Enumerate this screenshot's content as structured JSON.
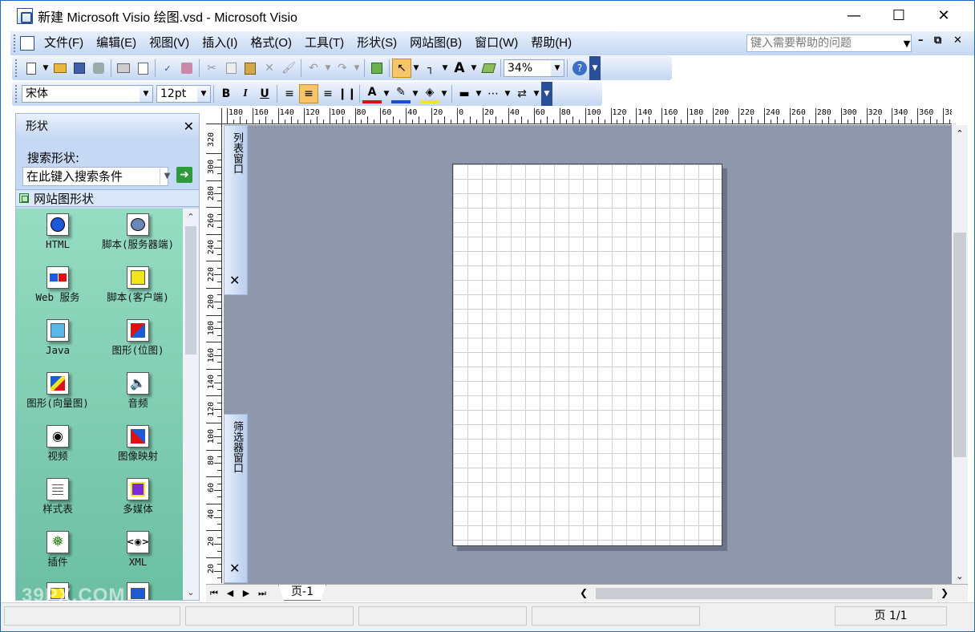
{
  "window": {
    "title": "新建 Microsoft Visio 绘图.vsd - Microsoft Visio"
  },
  "menu": {
    "items": [
      "文件(F)",
      "编辑(E)",
      "视图(V)",
      "插入(I)",
      "格式(O)",
      "工具(T)",
      "形状(S)",
      "网站图(B)",
      "窗口(W)",
      "帮助(H)"
    ],
    "help_placeholder": "键入需要帮助的问题"
  },
  "toolbar": {
    "zoom": "34%"
  },
  "format_toolbar": {
    "font": "宋体",
    "size": "12pt"
  },
  "shapes_panel": {
    "title": "形状",
    "search_label": "搜索形状:",
    "search_placeholder": "在此键入搜索条件",
    "stencil_name": "网站图形状",
    "items": [
      {
        "label": "HTML",
        "icon": "globe-icon"
      },
      {
        "label": "脚本(服务器端)",
        "icon": "server-script-icon"
      },
      {
        "label": "Web 服务",
        "icon": "web-service-icon"
      },
      {
        "label": "脚本(客户端)",
        "icon": "client-script-icon"
      },
      {
        "label": "Java",
        "icon": "java-icon"
      },
      {
        "label": "图形(位图)",
        "icon": "bitmap-icon"
      },
      {
        "label": "图形(向量图)",
        "icon": "vector-icon"
      },
      {
        "label": "音频",
        "icon": "audio-icon"
      },
      {
        "label": "视频",
        "icon": "video-icon"
      },
      {
        "label": "图像映射",
        "icon": "image-map-icon"
      },
      {
        "label": "样式表",
        "icon": "stylesheet-icon"
      },
      {
        "label": "多媒体",
        "icon": "multimedia-icon"
      },
      {
        "label": "插件",
        "icon": "plugin-icon"
      },
      {
        "label": "XML",
        "icon": "xml-icon"
      }
    ]
  },
  "docked": {
    "list_window": "列表窗口",
    "filter_window": "筛选器窗口"
  },
  "ruler": {
    "h_labels": [
      "180",
      "160",
      "140",
      "120",
      "100",
      "80",
      "60",
      "40",
      "20",
      "0",
      "20",
      "40",
      "60",
      "80",
      "100",
      "120",
      "140",
      "160",
      "180",
      "200",
      "220",
      "240",
      "260",
      "280",
      "300",
      "320",
      "340",
      "360",
      "38"
    ],
    "v_labels": [
      "320",
      "300",
      "280",
      "260",
      "240",
      "220",
      "200",
      "180",
      "160",
      "140",
      "120",
      "100",
      "80",
      "60",
      "40",
      "20",
      "20"
    ]
  },
  "tabs": {
    "page": "页-1"
  },
  "status": {
    "page_indicator": "页 1/1"
  },
  "watermark": "39PX.COM"
}
